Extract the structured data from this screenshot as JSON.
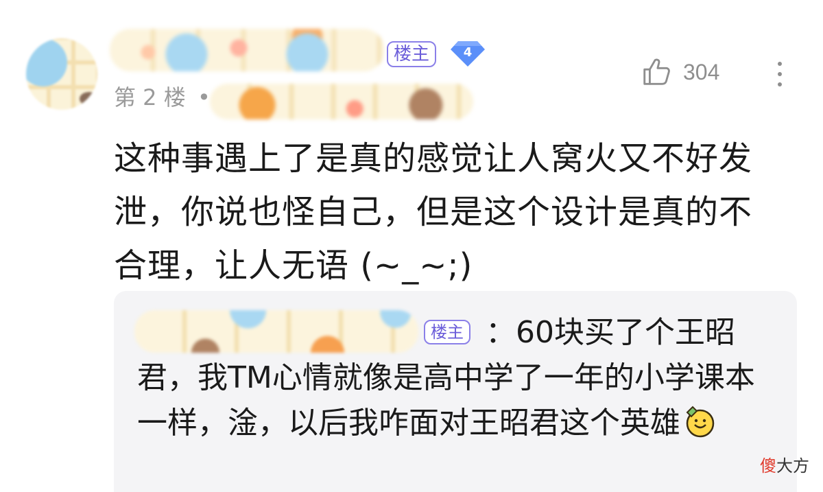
{
  "post": {
    "badge": {
      "owner_label": "楼主",
      "level": "4"
    },
    "floor_label": "第 2 楼",
    "dot": "•",
    "like_count": "304",
    "comment_text": "这种事遇上了是真的感觉让人窝火又不好发泄，你说也怪自己，但是这个设计是真的不合理，让人无语 (~_~;)"
  },
  "reply": {
    "owner_label": "楼主",
    "text": "：60块买了个王昭君，我TM心情就像是高中学了一年的小学课本一样，淦，以后我咋面对王昭君这个英雄",
    "emoji": "face-emoji"
  },
  "watermark": {
    "accent": "傻",
    "rest": "大方"
  },
  "icons": {
    "like": "thumbs-up-icon",
    "more": "more-vertical-icon",
    "level": "diamond-level-icon"
  },
  "colors": {
    "tag_border": "#8a7fe8",
    "tag_text": "#6a5cd9",
    "level_badge": "#5b8ff9",
    "reply_bg": "#f4f4f6",
    "watermark_accent": "#e03a2c"
  }
}
